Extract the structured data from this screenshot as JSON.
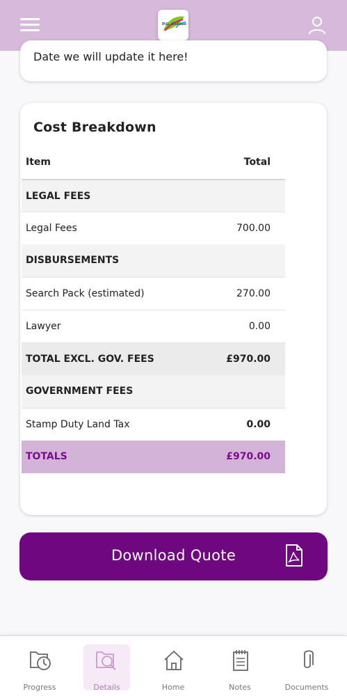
{
  "header": {
    "menu_icon": "hamburger-menu-icon",
    "logo_text": "P.G. Collins",
    "user_icon": "user-profile-icon"
  },
  "info_card": {
    "text": "Date we will update it here!"
  },
  "cost_breakdown": {
    "title": "Cost Breakdown",
    "header": {
      "item": "Item",
      "total": "Total"
    },
    "rows": [
      {
        "type": "section",
        "label": "LEGAL FEES",
        "value": ""
      },
      {
        "type": "item",
        "label": "Legal Fees",
        "value": "700.00"
      },
      {
        "type": "section",
        "label": "DISBURSEMENTS",
        "value": ""
      },
      {
        "type": "item",
        "label": "Search Pack (estimated)",
        "value": "270.00"
      },
      {
        "type": "item",
        "label": "Lawyer",
        "value": "0.00"
      },
      {
        "type": "subtotal",
        "label": "TOTAL EXCL. GOV. FEES",
        "value": "£970.00"
      },
      {
        "type": "section",
        "label": "GOVERNMENT FEES",
        "value": ""
      },
      {
        "type": "item",
        "label": "Stamp Duty Land Tax",
        "value": "0.00"
      },
      {
        "type": "totals",
        "label": "TOTALS",
        "value": "£970.00"
      }
    ]
  },
  "download": {
    "label": "Download Quote",
    "icon": "pdf-file-icon"
  },
  "bottom_nav": {
    "active": "Details",
    "items": [
      {
        "label": "Progress",
        "icon": "progress-clock-icon"
      },
      {
        "label": "Details",
        "icon": "details-search-icon"
      },
      {
        "label": "Home",
        "icon": "home-icon"
      },
      {
        "label": "Notes",
        "icon": "notes-icon"
      },
      {
        "label": "Documents",
        "icon": "paperclip-icon"
      }
    ]
  },
  "colors": {
    "header_bg": "#d7b9dc",
    "primary": "#6e0780",
    "totals_bg": "#d3b3d8",
    "totals_text": "#7a0d8c"
  }
}
